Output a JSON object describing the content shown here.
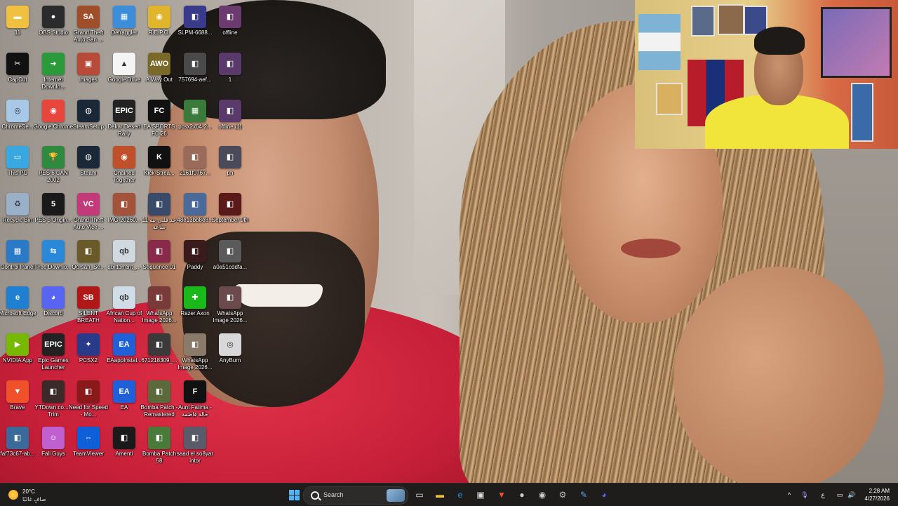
{
  "desktop": {
    "icons": [
      {
        "label": "11",
        "glyph": "▬",
        "color": "#f0c040"
      },
      {
        "label": "OBS Studio",
        "glyph": "●",
        "color": "#2b2b2b"
      },
      {
        "label": "Grand Theft Auto San ...",
        "glyph": "SA",
        "color": "#a04e2a"
      },
      {
        "label": "Defraggler",
        "glyph": "▦",
        "color": "#3c8edb"
      },
      {
        "label": "R.E.P.O.",
        "glyph": "◉",
        "color": "#e1b52b"
      },
      {
        "label": "SLPM-6688...",
        "glyph": "◧",
        "color": "#3a3a8a"
      },
      {
        "label": "offline",
        "glyph": "◧",
        "color": "#6b3b6f"
      },
      {
        "label": "CapCut",
        "glyph": "✂",
        "color": "#111111"
      },
      {
        "label": "Internet Downlo...",
        "glyph": "➜",
        "color": "#2a9a3a"
      },
      {
        "label": "images",
        "glyph": "▣",
        "color": "#b84a3a"
      },
      {
        "label": "Google Drive",
        "glyph": "▲",
        "color": "#f4f4f4"
      },
      {
        "label": "A Way Out",
        "glyph": "AWO",
        "color": "#7a6a2a"
      },
      {
        "label": "757694-aef...",
        "glyph": "◧",
        "color": "#4a4a4a"
      },
      {
        "label": "1",
        "glyph": "◧",
        "color": "#5a3a6a"
      },
      {
        "label": "ChromeSe...",
        "glyph": "◎",
        "color": "#a8c8e8"
      },
      {
        "label": "Google Chrome",
        "glyph": "◉",
        "color": "#e8453c"
      },
      {
        "label": "SteamSetup",
        "glyph": "◍",
        "color": "#1b2838"
      },
      {
        "label": "Dakar Desert Rally",
        "glyph": "EPIC",
        "color": "#222222"
      },
      {
        "label": "EA SPORTS FC 26",
        "glyph": "FC",
        "color": "#111111"
      },
      {
        "label": "pcsx2x64-2...",
        "glyph": "▦",
        "color": "#3a7a3a"
      },
      {
        "label": "offline (1)",
        "glyph": "◧",
        "color": "#5a3a6a"
      },
      {
        "label": "This PC",
        "glyph": "▭",
        "color": "#3aa8e0"
      },
      {
        "label": "PES 6 CAN 2002",
        "glyph": "🏆",
        "color": "#2e8a3e"
      },
      {
        "label": "Steam",
        "glyph": "◍",
        "color": "#1b2838"
      },
      {
        "label": "Chained Together",
        "glyph": "◉",
        "color": "#c0502a"
      },
      {
        "label": "Kick-Strea...",
        "glyph": "K",
        "color": "#111111"
      },
      {
        "label": "2161f0767...",
        "glyph": "◧",
        "color": "#9a6a5a"
      },
      {
        "label": "pn",
        "glyph": "◧",
        "color": "#4a4a5a"
      },
      {
        "label": "Recycle Bin",
        "glyph": "♻",
        "color": "#9ab0c8"
      },
      {
        "label": "PES 5 Origin...",
        "glyph": "5",
        "color": "#1a1a1a"
      },
      {
        "label": "Grand Theft Auto Vice ...",
        "glyph": "VC",
        "color": "#c23a7a"
      },
      {
        "label": "IMG-20260...",
        "glyph": "◧",
        "color": "#a5523a"
      },
      {
        "label": "خد قلبي بيه 11 ساعه",
        "glyph": "◧",
        "color": "#3a4a6a"
      },
      {
        "label": "48e13bb8e8...",
        "glyph": "◧",
        "color": "#4a6a9a"
      },
      {
        "label": "September 9th",
        "glyph": "◧",
        "color": "#5a1a1a"
      },
      {
        "label": "Control Panel",
        "glyph": "▦",
        "color": "#2a7ac8"
      },
      {
        "label": "Free Downlo...",
        "glyph": "⇆",
        "color": "#2a88d8"
      },
      {
        "label": "Qorsan_Se...",
        "glyph": "◧",
        "color": "#6a5a2a"
      },
      {
        "label": "qbittorrent_...",
        "glyph": "qb",
        "color": "#d0d8e0"
      },
      {
        "label": "Sequence 01",
        "glyph": "◧",
        "color": "#8a2a4a"
      },
      {
        "label": "Paddy",
        "glyph": "◧",
        "color": "#3a1a1a"
      },
      {
        "label": "a0a51cddfa...",
        "glyph": "◧",
        "color": "#5a5a5a"
      },
      {
        "label": "Microsoft Edge",
        "glyph": "e",
        "color": "#1f7fd0"
      },
      {
        "label": "Discord",
        "glyph": "◕",
        "color": "#5865f2"
      },
      {
        "label": "SILENT BREATH",
        "glyph": "SB",
        "color": "#b01818"
      },
      {
        "label": "African Cup of Nation...",
        "glyph": "qb",
        "color": "#d0dce8"
      },
      {
        "label": "WhatsApp Image 2026...",
        "glyph": "◧",
        "color": "#7a3a3a"
      },
      {
        "label": "Razer Axon",
        "glyph": "✚",
        "color": "#1ab81a"
      },
      {
        "label": "WhatsApp Image 2026...",
        "glyph": "◧",
        "color": "#6a4a4a"
      },
      {
        "label": "NVIDIA App",
        "glyph": "▶",
        "color": "#76b900"
      },
      {
        "label": "Epic Games Launcher",
        "glyph": "EPIC",
        "color": "#222222"
      },
      {
        "label": "PCSX2",
        "glyph": "✦",
        "color": "#2a3a8a"
      },
      {
        "label": "EAappInstal...",
        "glyph": "EA",
        "color": "#1f5fd8"
      },
      {
        "label": "671218309_...",
        "glyph": "◧",
        "color": "#3a3a3a"
      },
      {
        "label": "WhatsApp Image 2026...",
        "glyph": "◧",
        "color": "#8a7a6a"
      },
      {
        "label": "AnyBurn",
        "glyph": "◎",
        "color": "#d8d8d8"
      },
      {
        "label": "Brave",
        "glyph": "▼",
        "color": "#f0502a"
      },
      {
        "label": "YTDown.co... - Trim",
        "glyph": "◧",
        "color": "#3a2a2a"
      },
      {
        "label": "Need for Speed - Mo...",
        "glyph": "◧",
        "color": "#8a1a1a"
      },
      {
        "label": "EA",
        "glyph": "EA",
        "color": "#1f5fd8"
      },
      {
        "label": "Bomba Patch - Remastered",
        "glyph": "◧",
        "color": "#5a6a3a"
      },
      {
        "label": "Aunt Fatima - حالة فاطمة",
        "glyph": "F",
        "color": "#111111"
      },
      {
        "label": "faf73c67-ab...",
        "glyph": "◧",
        "color": "#3a6a9a"
      },
      {
        "label": "Fall Guys",
        "glyph": "☺",
        "color": "#c060d0"
      },
      {
        "label": "TeamViewer",
        "glyph": "⇔",
        "color": "#0e5fd8"
      },
      {
        "label": "Amenti",
        "glyph": "◧",
        "color": "#1a1a1a"
      },
      {
        "label": "Bomba Patch 58",
        "glyph": "◧",
        "color": "#4a7a3a"
      },
      {
        "label": "saad el so8yar intor",
        "glyph": "◧",
        "color": "#5a5a6a"
      }
    ]
  },
  "taskbar": {
    "weather": {
      "temp": "20°C",
      "condition": "صافٍ غالبًا"
    },
    "search_label": "Search",
    "apps": [
      {
        "name": "task-view",
        "glyph": "▭"
      },
      {
        "name": "file-explorer",
        "glyph": "▬"
      },
      {
        "name": "edge",
        "glyph": "e"
      },
      {
        "name": "store",
        "glyph": "▣"
      },
      {
        "name": "brave",
        "glyph": "▼"
      },
      {
        "name": "obs",
        "glyph": "●"
      },
      {
        "name": "webcam-app",
        "glyph": "◉"
      },
      {
        "name": "settings",
        "glyph": "⚙"
      },
      {
        "name": "capture",
        "glyph": "✎"
      },
      {
        "name": "discord",
        "glyph": "◕"
      }
    ],
    "tray": {
      "chevron": "^",
      "mic": "🎙",
      "ime": "ع",
      "display": "▭",
      "volume": "🔊"
    },
    "clock": {
      "time": "2:28 AM",
      "date": "4/27/2026"
    }
  },
  "colors": {
    "taskbar_bg": "#1f1c1c",
    "accent": "#4fb3f6"
  }
}
